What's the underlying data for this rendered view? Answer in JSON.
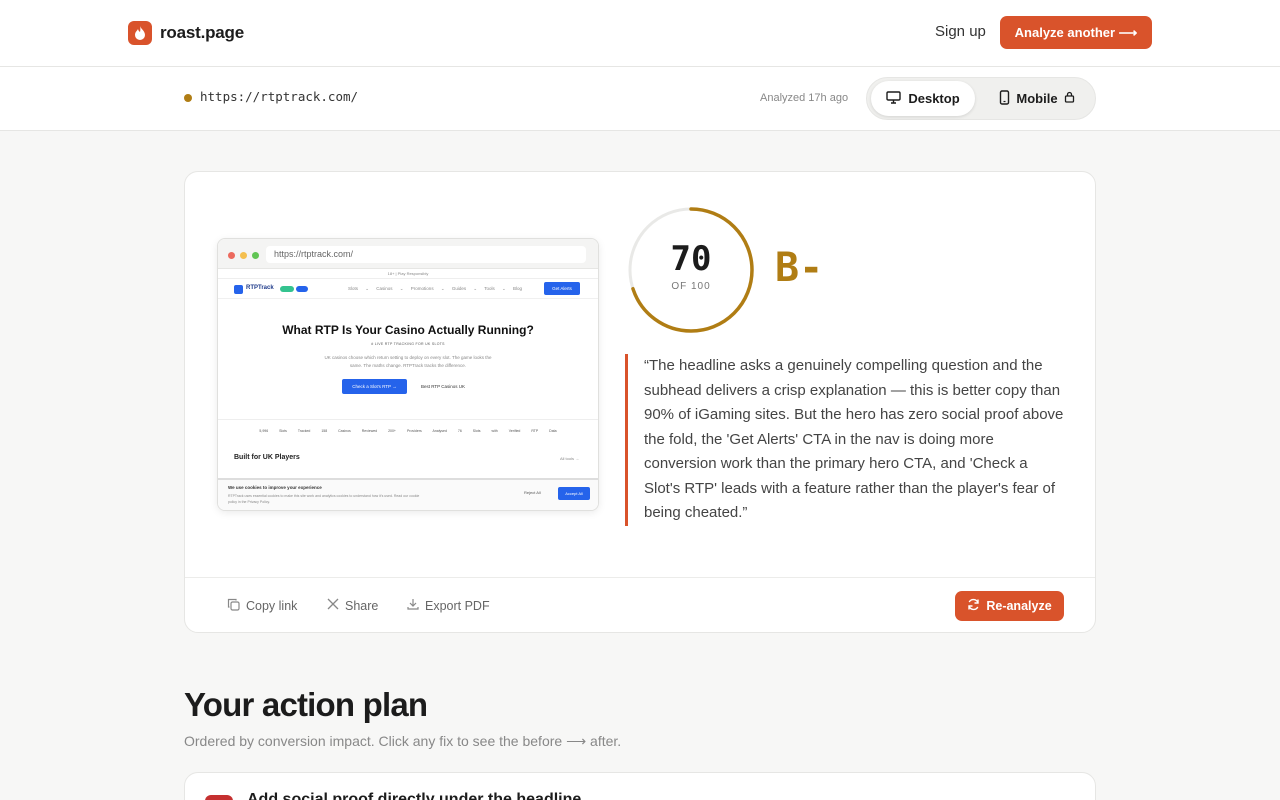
{
  "brand": {
    "name": "roast.page",
    "icon": "flame-icon",
    "accent": "#d9532b"
  },
  "nav": {
    "signup": "Sign up",
    "analyze_another": "Analyze another ⟶"
  },
  "urlbar": {
    "url": "https://rtptrack.com/",
    "status_color": "#b07d14",
    "analyzed": "Analyzed 17h ago",
    "toggle": {
      "desktop": "Desktop",
      "mobile": "Mobile",
      "selected": "Desktop"
    }
  },
  "screenshot": {
    "url": "https://rtptrack.com/",
    "topbar": "18+ | Play Responsibly",
    "logo": "RTPTrack",
    "menu": "Slots ⌄  Casinos ⌄  Promotions ⌄  Guides ⌄  Tools ⌄  Blog",
    "cta": "Get Alerts",
    "headline": "What RTP Is Your Casino Actually Running?",
    "kicker": "# LIVE RTP TRACKING FOR UK SLOTS",
    "subhead": "UK casinos choose which return setting to deploy on every slot. The game looks the same. The maths change. RTPTrack tracks the difference.",
    "primary_btn": "Check a Slot's RTP →",
    "secondary_btn": "Best RTP Casinos UK",
    "stats": "5,996 Slots Tracked   158 Casinos Reviewed   200+ Providers Analysed   76 Slots with Verified RTP Data",
    "section": "Built for UK Players",
    "all_tools": "All tools →",
    "cookie_title": "We use cookies to improve your experience",
    "cookie_text": "RTPTrack uses essential cookies to make this site work and analytics cookies to understand how it's used. Read our cookie policy in the Privacy Policy.",
    "reject": "Reject All",
    "accept": "Accept All"
  },
  "score": {
    "value": "70",
    "of": "OF 100",
    "fraction": 0.7,
    "grade": "B-",
    "grade_color": "#b07d14"
  },
  "verdict": "“The headline asks a genuinely compelling question and the subhead delivers a crisp explanation — this is better copy than 90% of iGaming sites. But the hero has zero social proof above the fold, the 'Get Alerts' CTA in the nav is doing more conversion work than the primary hero CTA, and 'Check a Slot's RTP' leads with a feature rather than the player's fear of being cheated.”",
  "actions": {
    "copy_link": "Copy link",
    "share": "Share",
    "export_pdf": "Export PDF",
    "reanalyze": "Re-analyze"
  },
  "plan": {
    "title": "Your action plan",
    "subtitle": "Ordered by conversion impact. Click any fix to see the before ⟶ after.",
    "items": [
      {
        "title": "Add social proof directly under the headline"
      }
    ]
  }
}
